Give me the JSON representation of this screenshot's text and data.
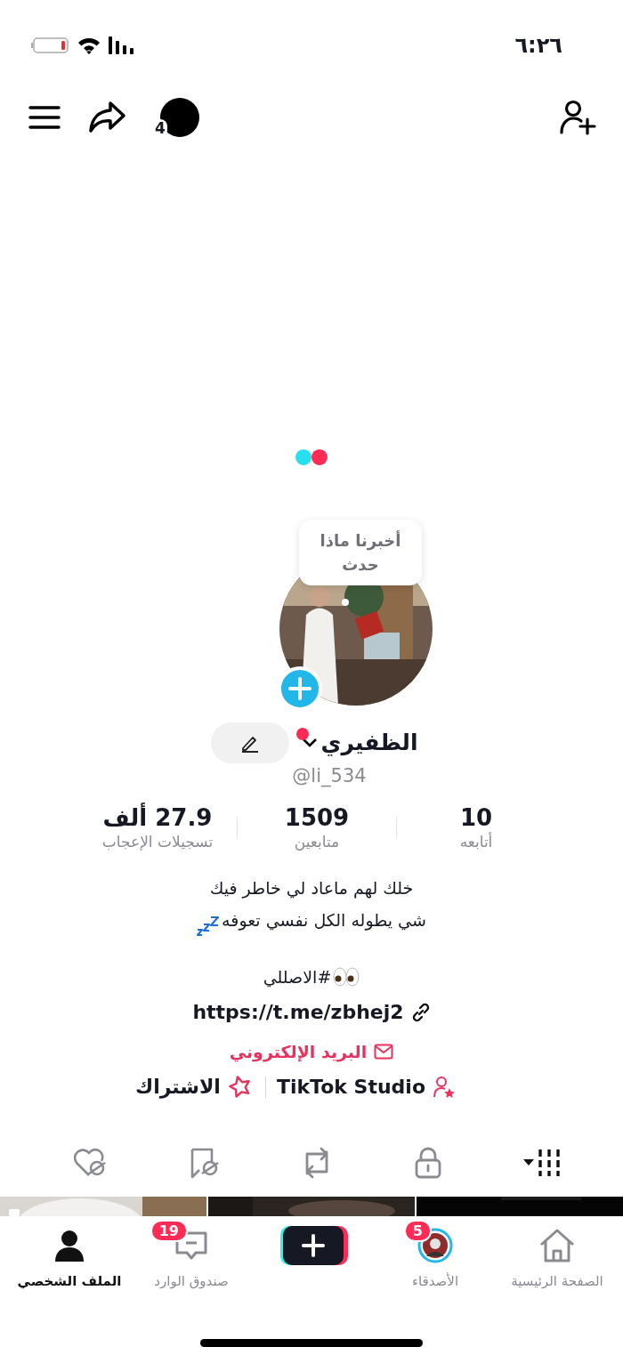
{
  "status_bar": {
    "time": "٦:٢٦"
  },
  "top_bar": {
    "story_count": "4"
  },
  "profile": {
    "bubble": "أخبرنا ماذا حدث",
    "name": "الظفيري",
    "new_dot": true,
    "handle": "@li_534"
  },
  "stats": [
    {
      "value": "10",
      "label": "أتابعه"
    },
    {
      "value": "1509",
      "label": "متابعين"
    },
    {
      "value": "27.9 ألف",
      "label": "تسجيلات الإعجاب"
    }
  ],
  "bio": {
    "lines": [
      "خلك لهم ماعاد لي خاطر فيك",
      "شي يطوله الكل نفسي تعوفه"
    ],
    "hashtag": "الاصللي#",
    "link": "https://t.me/zbhej2",
    "email": "البريد الإلكتروني"
  },
  "actions": [
    {
      "kind": "studio",
      "label": "TikTok Studio"
    },
    {
      "kind": "subscribe",
      "label": "الاشتراك"
    }
  ],
  "content_tabs": [
    {
      "kind": "grid",
      "selected": true
    },
    {
      "kind": "lock",
      "selected": false
    },
    {
      "kind": "repost",
      "selected": false
    },
    {
      "kind": "saved",
      "selected": false
    },
    {
      "kind": "liked",
      "selected": false
    }
  ],
  "bottom_nav": [
    {
      "kind": "home",
      "label": "الصفحة الرئيسية",
      "selected": false
    },
    {
      "kind": "friends",
      "label": "الأصدقاء",
      "badge": "5",
      "selected": false
    },
    {
      "kind": "create",
      "selected": false
    },
    {
      "kind": "inbox",
      "label": "صندوق الوارد",
      "badge": "19",
      "selected": false
    },
    {
      "kind": "profile",
      "label": "الملف الشخصي",
      "selected": true
    }
  ]
}
